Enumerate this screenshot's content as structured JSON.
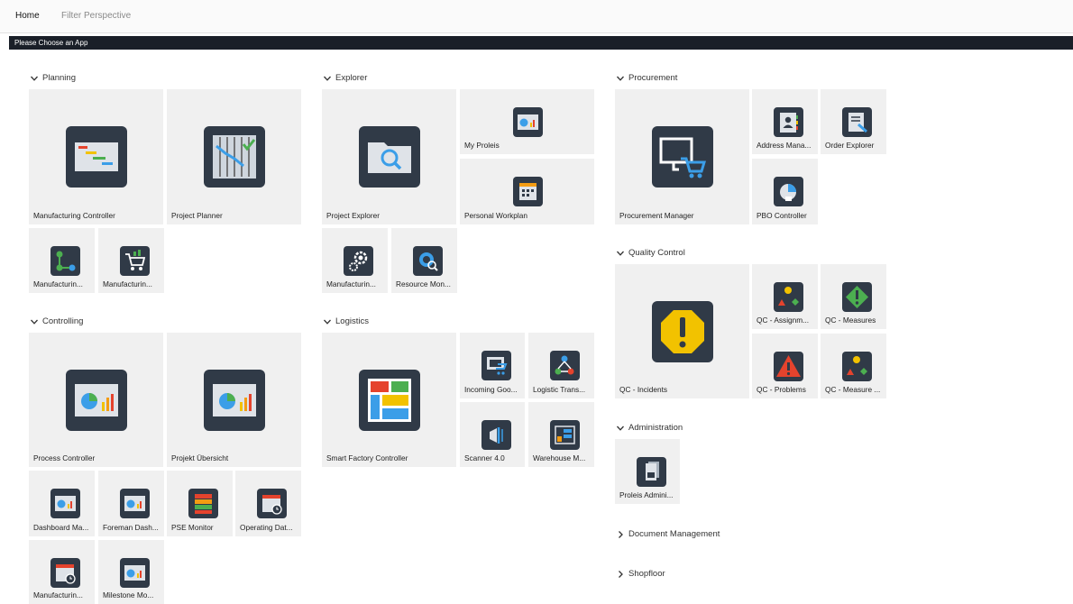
{
  "nav": {
    "home": "Home",
    "filter": "Filter Perspective"
  },
  "banner": "Please Choose an App",
  "groups": {
    "planning": {
      "title": "Planning",
      "tiles": [
        "Manufacturing Controller",
        "Project Planner",
        "Manufacturin...",
        "Manufacturin..."
      ]
    },
    "explorer": {
      "title": "Explorer",
      "tiles": [
        "Project Explorer",
        "My Proleis",
        "Personal Workplan",
        "Manufacturin...",
        "Resource Mon..."
      ]
    },
    "procurement": {
      "title": "Procurement",
      "tiles": [
        "Procurement Manager",
        "Address Mana...",
        "Order Explorer",
        "PBO Controller"
      ]
    },
    "controlling": {
      "title": "Controlling",
      "tiles": [
        "Process Controller",
        "Projekt Übersicht",
        "Dashboard Ma...",
        "Foreman Dash...",
        "PSE Monitor",
        "Operating Dat...",
        "Manufacturin...",
        "Milestone Mo..."
      ]
    },
    "logistics": {
      "title": "Logistics",
      "tiles": [
        "Smart Factory Controller",
        "Incoming Goo...",
        "Logistic Trans...",
        "Scanner 4.0",
        "Warehouse M..."
      ]
    },
    "quality": {
      "title": "Quality Control",
      "tiles": [
        "QC - Incidents",
        "QC - Assignm...",
        "QC - Measures",
        "QC - Problems",
        "QC - Measure ..."
      ]
    },
    "administration": {
      "title": "Administration",
      "tiles": [
        "Proleis Admini..."
      ]
    },
    "document": {
      "title": "Document Management"
    },
    "shopfloor": {
      "title": "Shopfloor"
    }
  },
  "colors": {
    "icon_bg": "#303a47",
    "banner_bg": "#1a1f28",
    "tile_bg": "#f0f0f0",
    "accent_blue": "#3b9ee8",
    "accent_green": "#4caf50",
    "accent_yellow": "#f2c200",
    "accent_red": "#e5432d",
    "accent_orange": "#f39c12"
  }
}
